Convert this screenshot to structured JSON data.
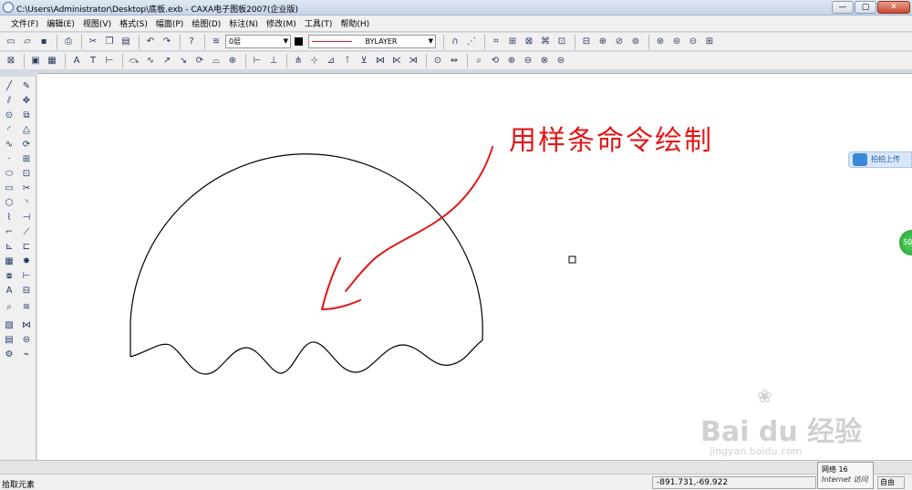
{
  "window": {
    "title": "C:\\Users\\Administrator\\Desktop\\底板.exb - CAXA电子图板2007(企业版)",
    "controls": [
      "—",
      "▢",
      "✕"
    ]
  },
  "menu": [
    "文件(F)",
    "编辑(E)",
    "视图(V)",
    "格式(S)",
    "幅面(P)",
    "绘图(D)",
    "标注(N)",
    "修改(M)",
    "工具(T)",
    "帮助(H)"
  ],
  "toolbar": {
    "layer": "0层",
    "linetype": "BYLAYER",
    "line_color": "#e02020"
  },
  "canvas": {
    "annotation": "用样条命令绘制",
    "annotation_color": "#e01818"
  },
  "overlays": {
    "baidu_button": "拍拍上传",
    "badge": "50",
    "network_label": "网络",
    "network_value": "16",
    "internet_label": "Internet 访问"
  },
  "watermark": {
    "main": "Bai du 经验",
    "sub": "jingyan.baidu.com"
  },
  "statusbar": {
    "prompt": "拾取元素",
    "coords": "-891.731,-69.922",
    "mode": "自由"
  }
}
